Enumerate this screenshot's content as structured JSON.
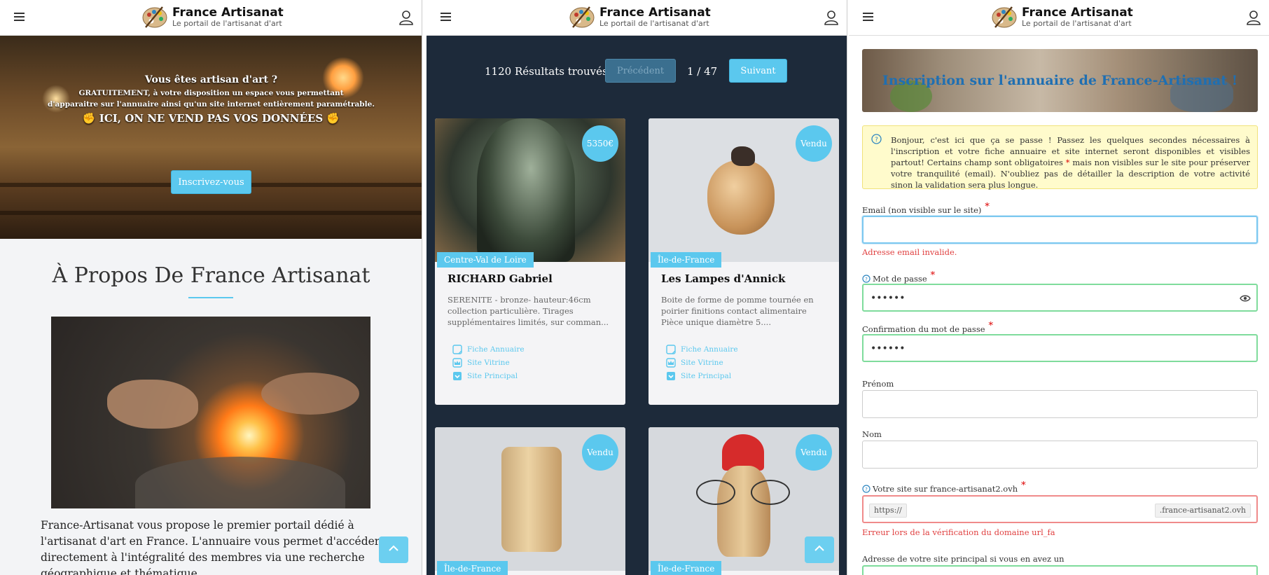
{
  "header": {
    "title": "France Artisanat",
    "subtitle": "Le portail de l'artisanat d'art"
  },
  "home": {
    "hero_line1": "Vous êtes artisan d'art ?",
    "hero_line2": "GRATUITEMENT, à votre disposition un espace vous permettant",
    "hero_line3": "d'apparaitre sur l'annuaire ainsi qu'un site internet entièrement paramétrable.",
    "hero_line4": "✊ ICI, ON NE VEND PAS VOS DONNÉES ✊",
    "register_button": "Inscrivez-vous",
    "about_title": "À Propos De France Artisanat",
    "about_text": "France-Artisanat vous propose le premier portail dédié à l'artisanat d'art en France. L'annuaire vous permet d'accéder directement à l'intégralité des membres via une recherche géographique et thématique."
  },
  "results": {
    "count_label": "1120 Résultats trouvés",
    "prev_label": "Précédent",
    "page_label": "1 / 47",
    "next_label": "Suivant",
    "link_labels": [
      "Fiche Annuaire",
      "Site Vitrine",
      "Site Principal"
    ],
    "cards": [
      {
        "badge": "5350€",
        "region": "Centre-Val de Loire",
        "title": "RICHARD Gabriel",
        "desc": "SERENITE - bronze- hauteur:46cm collection particulière. Tirages supplémentaires limités, sur comman..."
      },
      {
        "badge": "Vendu",
        "region": "Île-de-France",
        "title": "Les Lampes d'Annick",
        "desc": "Boite de forme de pomme tournée en poirier finitions contact alimentaire Pièce unique diamètre 5...."
      },
      {
        "badge": "Vendu",
        "region": "Île-de-France",
        "title": "",
        "desc": ""
      },
      {
        "badge": "Vendu",
        "region": "Île-de-France",
        "title": "",
        "desc": ""
      }
    ]
  },
  "signup": {
    "banner_title": "Inscription sur l'annuaire de France-Artisanat !",
    "info_before": "Bonjour, c'est ici que ça se passe ! Passez les quelques secondes nécessaires à l'inscription et votre fiche annuaire et site internet seront disponibles et visibles partout! Certains champ sont obligatoires",
    "info_star": "*",
    "info_after": "mais non visibles sur le site pour préserver votre tranquilité (email). N'oubliez pas de détailler la description de votre activité sinon la validation sera plus longue.",
    "email_label": "Email (non visible sur le site)",
    "email_error": "Adresse email invalide.",
    "password_label": "Mot de passe",
    "password_value": "••••••",
    "confirm_label": "Confirmation du mot de passe",
    "confirm_value": "••••••",
    "firstname_label": "Prénom",
    "lastname_label": "Nom",
    "site_label": "Votre site sur france-artisanat2.ovh",
    "site_prefix": "https://",
    "site_suffix": ".france-artisanat2.ovh",
    "site_error": "Erreur lors de la vérification du domaine url_fa",
    "main_site_label": "Adresse de votre site principal si vous en avez un",
    "required_mark": "*"
  },
  "colors": {
    "accent": "#5bc8ee",
    "dark_bg": "#1d2a3a",
    "error": "#e04040",
    "valid": "#7fdc9c",
    "title_blue": "#1f6fb2"
  },
  "icons": [
    "hamburger-icon",
    "palette-logo-icon",
    "user-icon",
    "chevron-up-icon",
    "question-circle-icon",
    "eye-icon",
    "sheet-icon",
    "crown-icon",
    "download-icon"
  ]
}
